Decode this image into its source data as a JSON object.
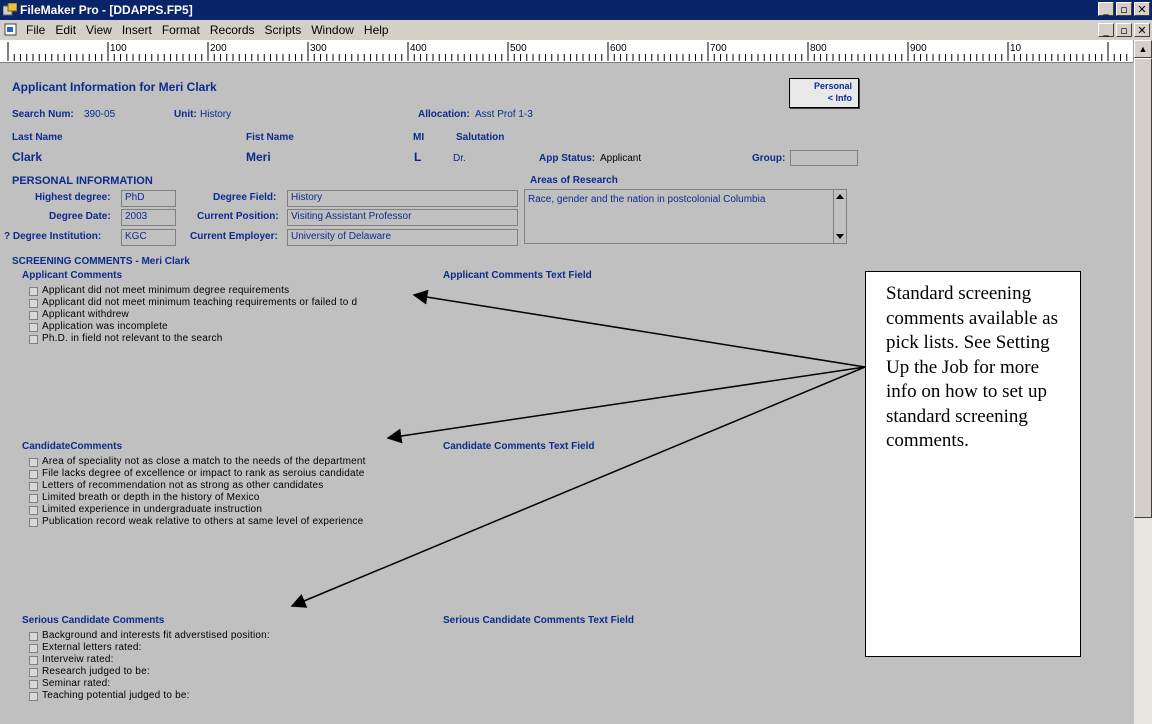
{
  "window": {
    "title": "FileMaker Pro - [DDAPPS.FP5]",
    "controls": [
      "_",
      "▫",
      "✕"
    ]
  },
  "menubar": {
    "items": [
      "File",
      "Edit",
      "View",
      "Insert",
      "Format",
      "Records",
      "Scripts",
      "Window",
      "Help"
    ]
  },
  "ruler": {
    "labels": [
      "100",
      "200",
      "300",
      "400",
      "500",
      "600",
      "700",
      "800",
      "900",
      "10"
    ]
  },
  "page": {
    "heading": "Applicant Information for Meri Clark",
    "personal_info_button": {
      "line1": "Personal",
      "line2": "<   Info"
    },
    "search_num_label": "Search Num:",
    "search_num_value": "390-05",
    "unit_label": "Unit:",
    "unit_value": "History",
    "allocation_label": "Allocation:",
    "allocation_value": "Asst Prof 1-3",
    "last_name_label": "Last Name",
    "first_name_label": "Fist Name",
    "mi_label": "MI",
    "salutation_label": "Salutation",
    "last_name_value": "Clark",
    "first_name_value": "Meri",
    "mi_value": "L",
    "salutation_value": "Dr.",
    "app_status_label": "App Status:",
    "app_status_value": "Applicant",
    "group_label": "Group:",
    "group_value": ""
  },
  "personal": {
    "section_title": "PERSONAL INFORMATION",
    "highest_degree_label": "Highest degree:",
    "highest_degree_value": "PhD",
    "degree_date_label": "Degree Date:",
    "degree_date_value": "2003",
    "degree_institution_label": "? Degree Institution:",
    "degree_institution_value": "KGC",
    "degree_field_label": "Degree Field:",
    "degree_field_value": "History",
    "current_position_label": "Current Position:",
    "current_position_value": "Visiting Assistant Professor",
    "current_employer_label": "Current Employer:",
    "current_employer_value": "University of Delaware",
    "areas_label": "Areas of Research",
    "areas_value": "Race, gender and the nation in postcolonial Columbia"
  },
  "screening": {
    "section_title": "SCREENING COMMENTS - Meri Clark",
    "applicant_title": "Applicant Comments",
    "applicant_text_title": "Applicant Comments Text Field",
    "applicant_items": [
      "Applicant did not meet minimum degree requirements",
      "Applicant did not meet minimum teaching requirements or failed to d",
      "Applicant withdrew",
      "Application was incomplete",
      "Ph.D. in field not relevant to the search"
    ],
    "candidate_title": "CandidateComments",
    "candidate_text_title": "Candidate Comments Text Field",
    "candidate_items": [
      "Area of speciality not as close a match to the needs of the department",
      "File lacks degree of excellence or impact to rank as seroius candidate",
      "Letters of recommendation not as strong as other candidates",
      "Limited breath or depth in the history of Mexico",
      "Limited experience in undergraduate instruction",
      "Publication record weak relative to others at same level of experience"
    ],
    "serious_title": "Serious Candidate Comments",
    "serious_text_title": "Serious Candidate Comments Text Field",
    "serious_items": [
      "Background and interests fit adverstised position:",
      "External letters rated:",
      "Interveiw rated:",
      "Research judged to be:",
      "Seminar rated:",
      "Teaching potential judged to be:"
    ]
  },
  "callout": {
    "text": "Standard screening comments available as pick lists. See Setting Up the Job for more info on how to set up standard screening comments."
  }
}
